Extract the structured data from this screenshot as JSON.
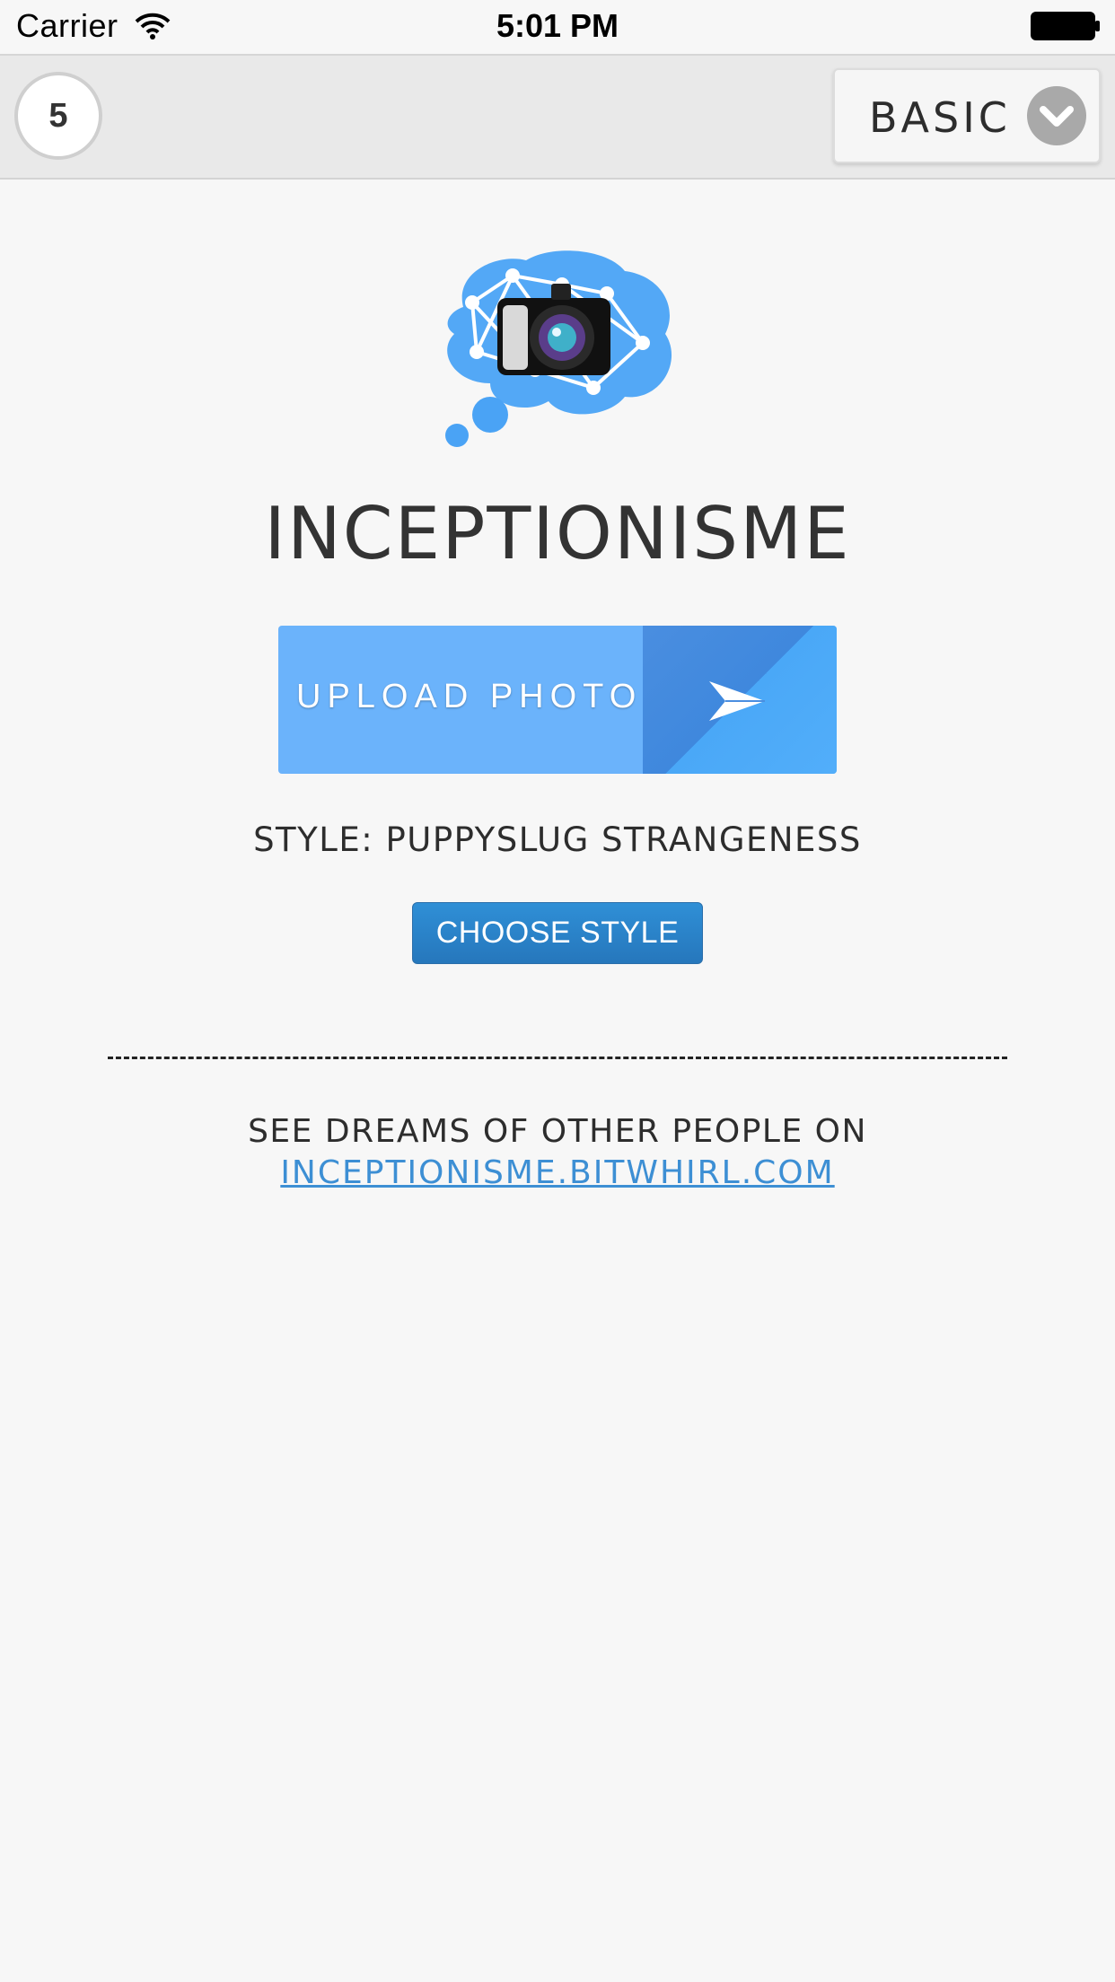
{
  "status_bar": {
    "carrier": "Carrier",
    "time": "5:01 PM"
  },
  "nav": {
    "counter": "5",
    "plan": "BASIC",
    "plan_icon": "chevron-down-icon"
  },
  "logo": {
    "icon": "brain-camera-logo",
    "brain_color": "#4aa3f5"
  },
  "app_title": "INCEPTIONISME",
  "upload": {
    "label": "UPLOAD PHOTO",
    "icon": "send-arrow-icon",
    "color": "#6bb3fb"
  },
  "style": {
    "text": "STYLE: PUPPYSLUG STRANGENESS",
    "choose_label": "CHOOSE STYLE",
    "button_color": "#2b84cc"
  },
  "footer": {
    "text": "SEE DREAMS OF OTHER PEOPLE ON",
    "link": "INCEPTIONISME.BITWHIRL.COM",
    "link_color": "#3d8fd4"
  }
}
